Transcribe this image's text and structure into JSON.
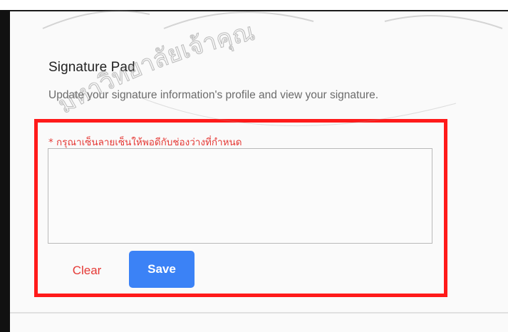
{
  "section": {
    "title": "Signature Pad",
    "subtitle": "Update your signature information's profile and view your signature."
  },
  "signature_form": {
    "required_note": "* กรุณาเซ็นลายเซ็นให้พอดีกับช่องว่างที่กำหนด",
    "clear_label": "Clear",
    "save_label": "Save"
  },
  "watermark": {
    "seal_text": "มหาวิทยาลัยเจ้าคุณ"
  },
  "colors": {
    "highlight": "#ff1a1a",
    "primary_button": "#3b82f6",
    "danger_text": "#e53935"
  }
}
